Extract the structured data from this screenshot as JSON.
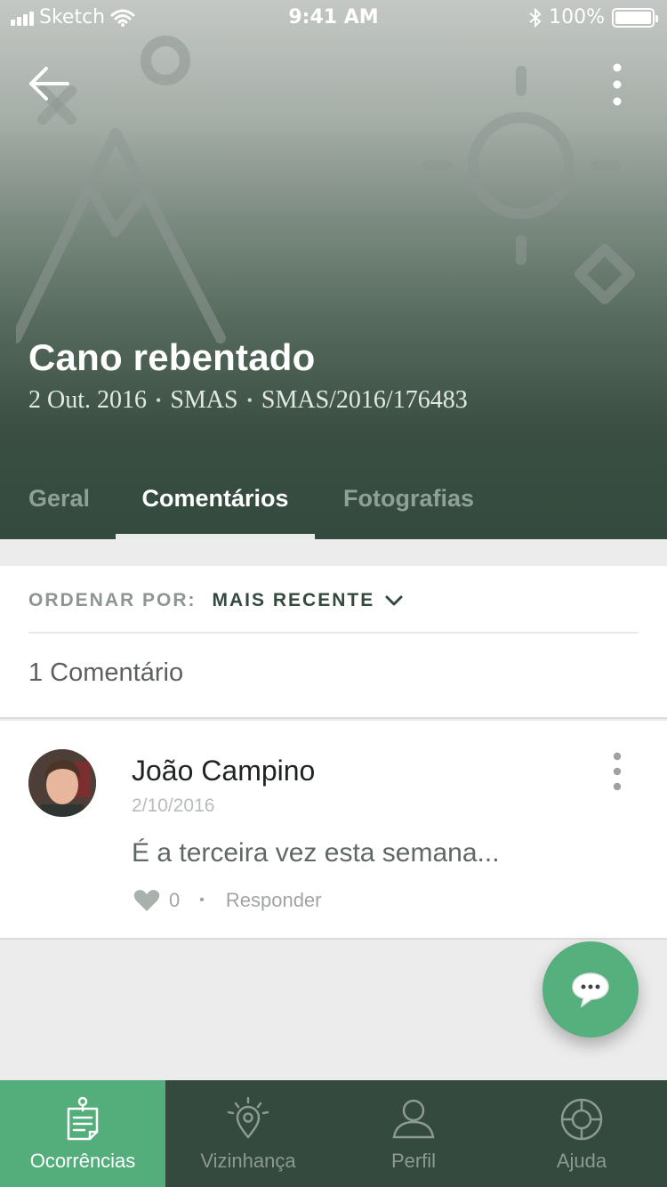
{
  "status_bar": {
    "carrier": "Sketch",
    "time": "9:41 AM",
    "battery": "100%"
  },
  "header": {
    "title": "Cano rebentado",
    "meta": [
      "2 Out. 2016",
      "SMAS",
      "SMAS/2016/176483"
    ],
    "meta_separator": "•"
  },
  "tabs": [
    {
      "label": "Geral"
    },
    {
      "label": "Comentários",
      "active": true
    },
    {
      "label": "Fotografias"
    }
  ],
  "sort": {
    "label": "ORDENAR POR:",
    "value": "MAIS RECENTE"
  },
  "comments_count": "1 Comentário",
  "comments": [
    {
      "author": "João Campino",
      "date": "2/10/2016",
      "text": "É a terceira vez esta semana...",
      "likes": "0",
      "separator": "•",
      "reply_label": "Responder"
    }
  ],
  "bottom_nav": [
    {
      "label": "Ocorrências",
      "icon": "report-icon",
      "active": true
    },
    {
      "label": "Vizinhança",
      "icon": "location-pin-icon"
    },
    {
      "label": "Perfil",
      "icon": "person-icon"
    },
    {
      "label": "Ajuda",
      "icon": "lifebuoy-icon"
    }
  ],
  "colors": {
    "primary_dark": "#344a3e",
    "accent_green": "#53ae7b"
  }
}
